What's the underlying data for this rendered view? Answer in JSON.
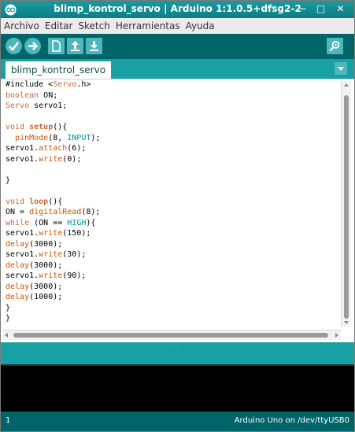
{
  "window": {
    "title": "blimp_kontrol_servo | Arduino 1:1.0.5+dfsg2-2"
  },
  "menu": {
    "items": [
      "Archivo",
      "Editar",
      "Sketch",
      "Herramientas",
      "Ayuda"
    ]
  },
  "toolbar": {
    "buttons": [
      "verify-icon",
      "upload-icon",
      "new-icon",
      "open-icon",
      "save-icon"
    ],
    "right_button": "serial-monitor-icon"
  },
  "tabs": [
    {
      "label": "blimp_kontrol_servo",
      "active": true
    }
  ],
  "editor": {
    "lines": [
      "#include <Servo.h>",
      "boolean ON;",
      "Servo servo1;",
      "",
      "void setup(){",
      "  pinMode(8, INPUT);",
      "servo1.attach(6);",
      "servo1.write(0);",
      "",
      "}",
      "",
      "void loop(){",
      "ON = digitalRead(8);",
      "while (ON == HIGH){",
      "servo1.write(150);",
      "delay(3000);",
      "servo1.write(30);",
      "delay(3000);",
      "servo1.write(90);",
      "delay(3000);",
      "delay(1000);",
      "}",
      "}"
    ]
  },
  "footer": {
    "line_number": "1",
    "board": "Arduino Uno on /dev/ttyUSB0"
  },
  "colors": {
    "accent": "#17a1a5",
    "toolbar": "#006468",
    "keyword": "#cc6633",
    "constant": "#00979d"
  }
}
